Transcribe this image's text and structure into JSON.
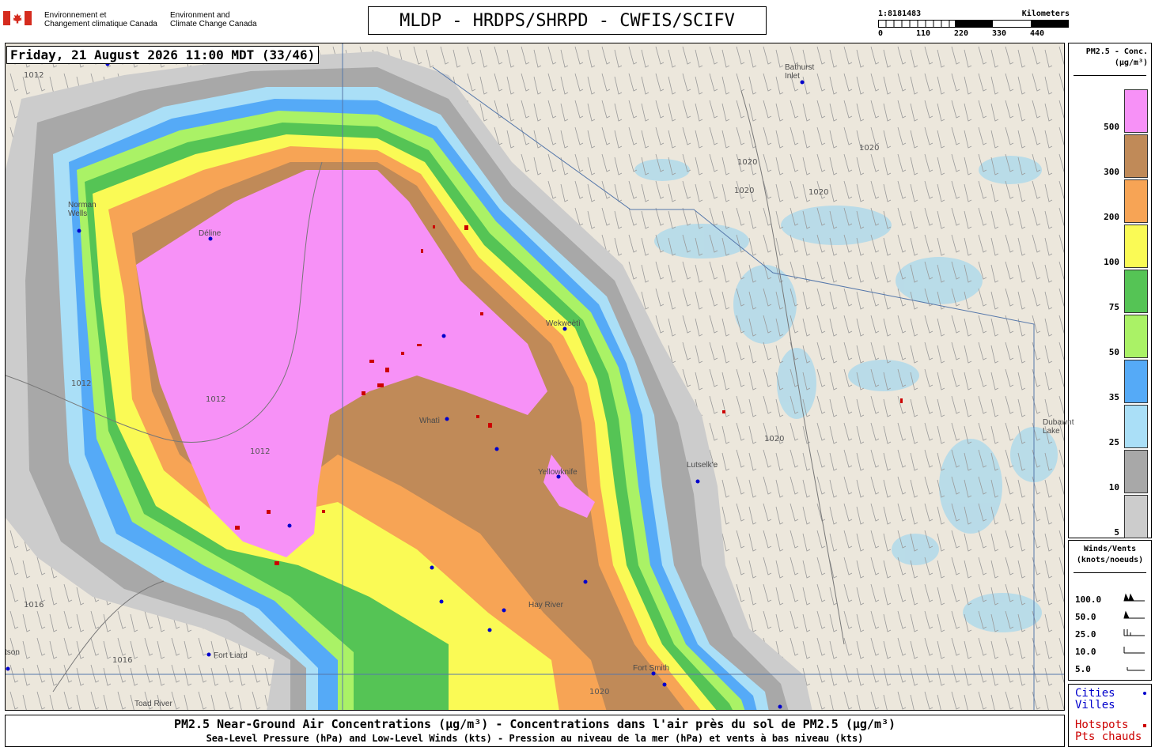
{
  "header": {
    "gov_fr_line1": "Environnement et",
    "gov_fr_line2": "Changement climatique Canada",
    "gov_en_line1": "Environment and",
    "gov_en_line2": "Climate Change Canada",
    "title": "MLDP - HRDPS/SHRPD - CWFIS/SCIFV"
  },
  "scale_bar": {
    "ratio": "1:8181483",
    "unit": "Kilometers",
    "ticks": [
      "0",
      "110",
      "220",
      "330",
      "440"
    ]
  },
  "timestamp": "Friday, 21 August 2026 11:00 MDT (33/46)",
  "places": {
    "bathurst": "Bathurst",
    "bathurst2": "Inlet",
    "norman1": "Norman",
    "norman2": "Wells",
    "deline": "Déline",
    "wekweeti": "Wekweètì",
    "whati": "Whatì",
    "yellowknife": "Yellowknife",
    "lutselke": "Lutselk'e",
    "hay_river": "Hay River",
    "fort_liard": "Fort Liard",
    "fort_smith": "Fort Smith",
    "toad_river": "Toad River",
    "watson": "tson",
    "dubawnt1": "Dubawnt",
    "dubawnt2": "Lake"
  },
  "isobars": {
    "p1012": "1012",
    "p1016": "1016",
    "p1020": "1020"
  },
  "legend_pm": {
    "title_line1": "PM2.5 - Conc.",
    "title_line2": "(µg/m³)",
    "levels": [
      {
        "label": "500",
        "color": "#f791f7"
      },
      {
        "label": "300",
        "color": "#c08a58"
      },
      {
        "label": "200",
        "color": "#f7a455"
      },
      {
        "label": "100",
        "color": "#fafa55"
      },
      {
        "label": "75",
        "color": "#55c455"
      },
      {
        "label": "50",
        "color": "#aaf266"
      },
      {
        "label": "35",
        "color": "#55aaf7"
      },
      {
        "label": "25",
        "color": "#aadff7"
      },
      {
        "label": "10",
        "color": "#a8a8a8"
      },
      {
        "label": "5",
        "color": "#cccccc"
      }
    ]
  },
  "legend_wind": {
    "title_line1": "Winds/Vents",
    "title_line2": "(knots/noeuds)",
    "speeds": [
      "100.0",
      "50.0",
      "25.0",
      "10.0",
      "5.0"
    ]
  },
  "legend_symbols": {
    "cities_en": "Cities",
    "cities_fr": "Villes",
    "hotspots_en": "Hotspots",
    "hotspots_fr": "Pts chauds",
    "city_color": "#0000cc",
    "hotspot_color": "#cc0000"
  },
  "footer": {
    "line1": "PM2.5 Near-Ground Air Concentrations (µg/m³) - Concentrations dans l'air près du sol de PM2.5 (µg/m³)",
    "line2": "Sea-Level Pressure (hPa) and Low-Level Winds (kts) - Pression au niveau de la mer (hPa) et vents à bas niveau (kts)"
  }
}
